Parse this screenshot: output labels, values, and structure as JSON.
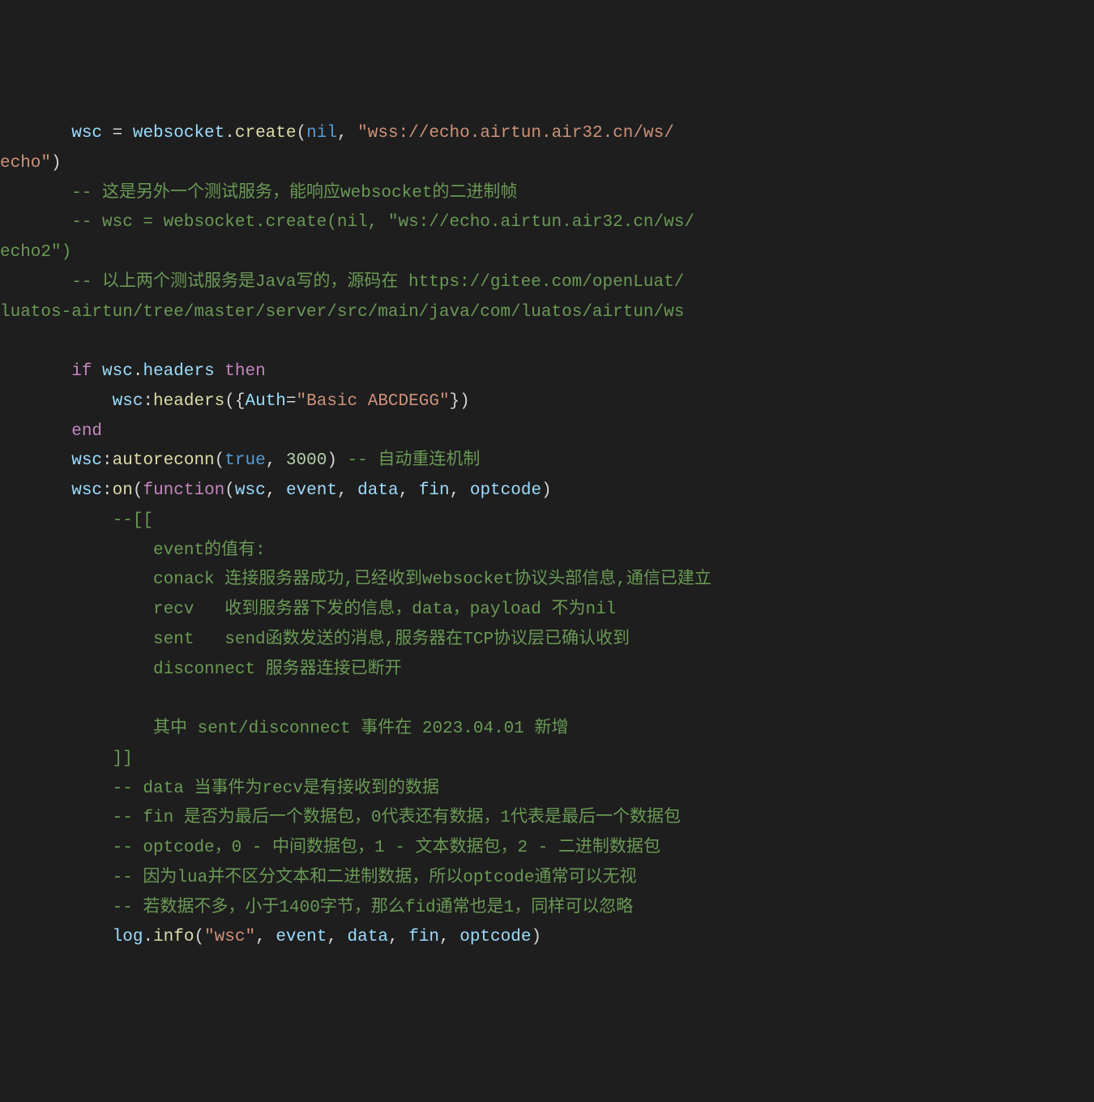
{
  "code": {
    "tokens": [
      {
        "cls": "c-ident",
        "txt": "       wsc "
      },
      {
        "cls": "c-punct",
        "txt": "= "
      },
      {
        "cls": "c-ident",
        "txt": "websocket"
      },
      {
        "cls": "c-punct",
        "txt": "."
      },
      {
        "cls": "c-func",
        "txt": "create"
      },
      {
        "cls": "c-punct",
        "txt": "("
      },
      {
        "cls": "c-boolnil",
        "txt": "nil"
      },
      {
        "cls": "c-punct",
        "txt": ", "
      },
      {
        "cls": "c-string",
        "txt": "\"wss://echo.airtun.air32.cn/ws/\necho\""
      },
      {
        "cls": "c-punct",
        "txt": ")"
      },
      {
        "cls": "c-punct",
        "txt": "\n"
      },
      {
        "cls": "c-comment",
        "txt": "       -- 这是另外一个测试服务，能响应websocket的二进制帧\n"
      },
      {
        "cls": "c-comment",
        "txt": "       -- wsc = websocket.create(nil, \"ws://echo.airtun.air32.cn/ws/\necho2\")\n"
      },
      {
        "cls": "c-comment",
        "txt": "       -- 以上两个测试服务是Java写的，源码在 https://gitee.com/openLuat/\nluatos-airtun/tree/master/server/src/main/java/com/luatos/airtun/ws\n"
      },
      {
        "cls": "c-punct",
        "txt": "\n"
      },
      {
        "cls": "c-punct",
        "txt": "       "
      },
      {
        "cls": "c-keyword",
        "txt": "if"
      },
      {
        "cls": "c-punct",
        "txt": " "
      },
      {
        "cls": "c-ident",
        "txt": "wsc"
      },
      {
        "cls": "c-punct",
        "txt": "."
      },
      {
        "cls": "c-ident",
        "txt": "headers"
      },
      {
        "cls": "c-punct",
        "txt": " "
      },
      {
        "cls": "c-keyword",
        "txt": "then"
      },
      {
        "cls": "c-punct",
        "txt": "\n"
      },
      {
        "cls": "c-punct",
        "txt": "           "
      },
      {
        "cls": "c-ident",
        "txt": "wsc"
      },
      {
        "cls": "c-punct",
        "txt": ":"
      },
      {
        "cls": "c-func",
        "txt": "headers"
      },
      {
        "cls": "c-punct",
        "txt": "({"
      },
      {
        "cls": "c-ident",
        "txt": "Auth"
      },
      {
        "cls": "c-punct",
        "txt": "="
      },
      {
        "cls": "c-string",
        "txt": "\"Basic ABCDEGG\""
      },
      {
        "cls": "c-punct",
        "txt": "})"
      },
      {
        "cls": "c-punct",
        "txt": "\n"
      },
      {
        "cls": "c-punct",
        "txt": "       "
      },
      {
        "cls": "c-keyword",
        "txt": "end"
      },
      {
        "cls": "c-punct",
        "txt": "\n"
      },
      {
        "cls": "c-punct",
        "txt": "       "
      },
      {
        "cls": "c-ident",
        "txt": "wsc"
      },
      {
        "cls": "c-punct",
        "txt": ":"
      },
      {
        "cls": "c-func",
        "txt": "autoreconn"
      },
      {
        "cls": "c-punct",
        "txt": "("
      },
      {
        "cls": "c-boolnil",
        "txt": "true"
      },
      {
        "cls": "c-punct",
        "txt": ", "
      },
      {
        "cls": "c-number",
        "txt": "3000"
      },
      {
        "cls": "c-punct",
        "txt": ") "
      },
      {
        "cls": "c-comment",
        "txt": "-- 自动重连机制"
      },
      {
        "cls": "c-punct",
        "txt": "\n"
      },
      {
        "cls": "c-punct",
        "txt": "       "
      },
      {
        "cls": "c-ident",
        "txt": "wsc"
      },
      {
        "cls": "c-punct",
        "txt": ":"
      },
      {
        "cls": "c-func",
        "txt": "on"
      },
      {
        "cls": "c-punct",
        "txt": "("
      },
      {
        "cls": "c-keyword",
        "txt": "function"
      },
      {
        "cls": "c-punct",
        "txt": "("
      },
      {
        "cls": "c-ident",
        "txt": "wsc"
      },
      {
        "cls": "c-punct",
        "txt": ", "
      },
      {
        "cls": "c-ident",
        "txt": "event"
      },
      {
        "cls": "c-punct",
        "txt": ", "
      },
      {
        "cls": "c-ident",
        "txt": "data"
      },
      {
        "cls": "c-punct",
        "txt": ", "
      },
      {
        "cls": "c-ident",
        "txt": "fin"
      },
      {
        "cls": "c-punct",
        "txt": ", "
      },
      {
        "cls": "c-ident",
        "txt": "optcode"
      },
      {
        "cls": "c-punct",
        "txt": ")"
      },
      {
        "cls": "c-punct",
        "txt": "\n"
      },
      {
        "cls": "c-comment",
        "txt": "           --[[\n"
      },
      {
        "cls": "c-comment",
        "txt": "               event的值有:\n"
      },
      {
        "cls": "c-comment",
        "txt": "               conack 连接服务器成功,已经收到websocket协议头部信息,通信已建立\n"
      },
      {
        "cls": "c-comment",
        "txt": "               recv   收到服务器下发的信息，data，payload 不为nil\n"
      },
      {
        "cls": "c-comment",
        "txt": "               sent   send函数发送的消息,服务器在TCP协议层已确认收到\n"
      },
      {
        "cls": "c-comment",
        "txt": "               disconnect 服务器连接已断开\n"
      },
      {
        "cls": "c-comment",
        "txt": "\n"
      },
      {
        "cls": "c-comment",
        "txt": "               其中 sent/disconnect 事件在 2023.04.01 新增\n"
      },
      {
        "cls": "c-comment",
        "txt": "           ]]\n"
      },
      {
        "cls": "c-comment",
        "txt": "           -- data 当事件为recv是有接收到的数据\n"
      },
      {
        "cls": "c-comment",
        "txt": "           -- fin 是否为最后一个数据包，0代表还有数据，1代表是最后一个数据包\n"
      },
      {
        "cls": "c-comment",
        "txt": "           -- optcode，0 - 中间数据包，1 - 文本数据包，2 - 二进制数据包\n"
      },
      {
        "cls": "c-comment",
        "txt": "           -- 因为lua并不区分文本和二进制数据，所以optcode通常可以无视\n"
      },
      {
        "cls": "c-comment",
        "txt": "           -- 若数据不多，小于1400字节，那么fid通常也是1，同样可以忽略\n"
      },
      {
        "cls": "c-punct",
        "txt": "           "
      },
      {
        "cls": "c-ident",
        "txt": "log"
      },
      {
        "cls": "c-punct",
        "txt": "."
      },
      {
        "cls": "c-func",
        "txt": "info"
      },
      {
        "cls": "c-punct",
        "txt": "("
      },
      {
        "cls": "c-string",
        "txt": "\"wsc\""
      },
      {
        "cls": "c-punct",
        "txt": ", "
      },
      {
        "cls": "c-ident",
        "txt": "event"
      },
      {
        "cls": "c-punct",
        "txt": ", "
      },
      {
        "cls": "c-ident",
        "txt": "data"
      },
      {
        "cls": "c-punct",
        "txt": ", "
      },
      {
        "cls": "c-ident",
        "txt": "fin"
      },
      {
        "cls": "c-punct",
        "txt": ", "
      },
      {
        "cls": "c-ident",
        "txt": "optcode"
      },
      {
        "cls": "c-punct",
        "txt": ")"
      }
    ]
  }
}
